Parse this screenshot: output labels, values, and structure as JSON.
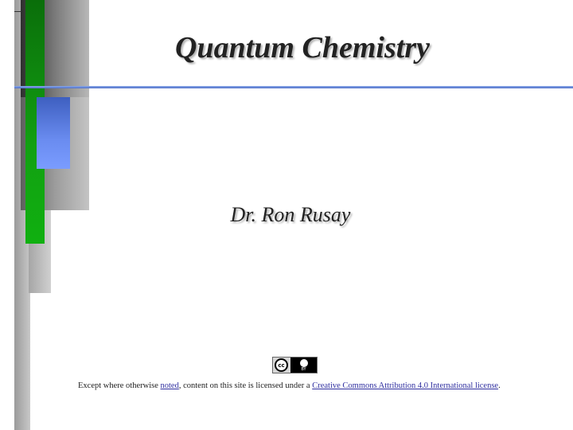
{
  "slide": {
    "title": "Quantum Chemistry",
    "author": "Dr. Ron Rusay"
  },
  "license": {
    "badge_icon": "cc-by-icon",
    "badge_cc_text": "cc",
    "badge_by_text": "BY",
    "prefix": "Except where otherwise ",
    "noted_link": "noted",
    "middle": ", content on this site is licensed under a ",
    "license_link": "Creative Commons Attribution 4.0 International license",
    "suffix": "."
  },
  "colors": {
    "accent_green": "#12a012",
    "accent_blue": "#6a8cf0",
    "link": "#3030a0"
  }
}
